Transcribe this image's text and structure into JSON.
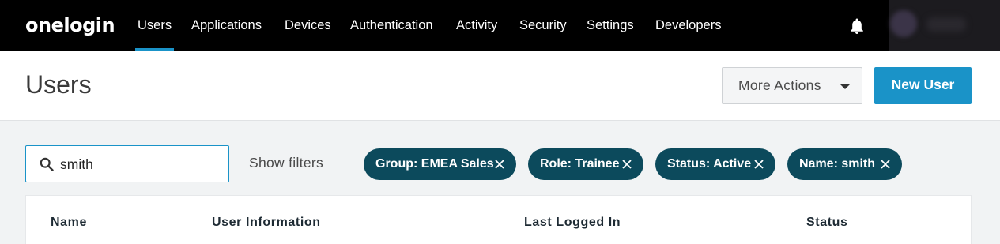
{
  "brand": {
    "logo": "onelogin",
    "accent": "#1a93c8",
    "chip_color": "#0c4a5c"
  },
  "nav": {
    "items": [
      {
        "label": "Users",
        "active": true
      },
      {
        "label": "Applications"
      },
      {
        "label": "Devices"
      },
      {
        "label": "Authentication"
      },
      {
        "label": "Activity"
      },
      {
        "label": "Security"
      },
      {
        "label": "Settings"
      },
      {
        "label": "Developers"
      }
    ],
    "notifications_icon": "bell-icon"
  },
  "header": {
    "title": "Users",
    "more_actions_label": "More Actions",
    "new_user_label": "New User"
  },
  "search": {
    "value": "smith",
    "icon": "search-icon"
  },
  "filters": {
    "show_filters_label": "Show filters",
    "chips": [
      {
        "label": "Group: EMEA Sales"
      },
      {
        "label": "Role: Trainee"
      },
      {
        "label": "Status: Active"
      },
      {
        "label": "Name: smith"
      }
    ]
  },
  "table": {
    "columns": [
      "Name",
      "User Information",
      "Last Logged In",
      "Status"
    ]
  }
}
